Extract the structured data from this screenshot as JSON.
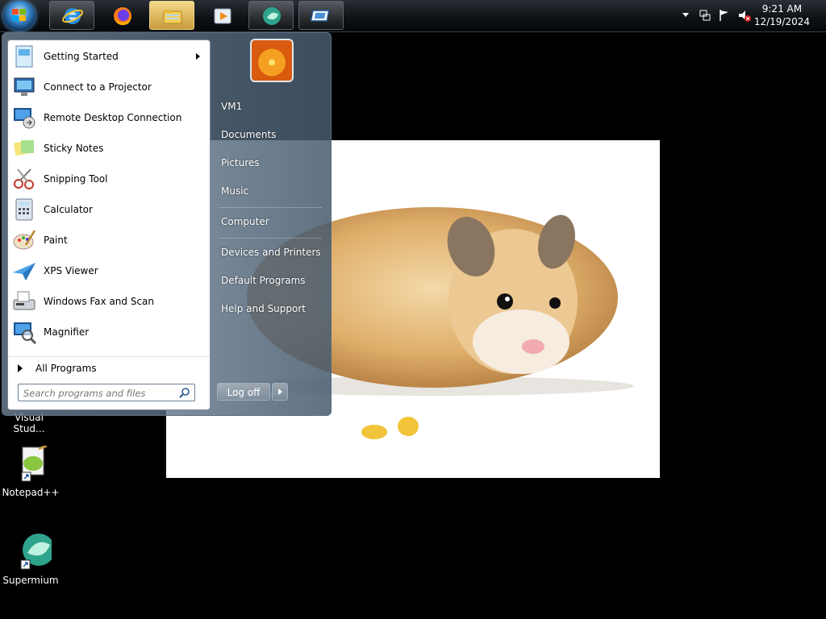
{
  "taskbar": {
    "pinned": [
      {
        "name": "internet-explorer",
        "active": false
      },
      {
        "name": "firefox",
        "active": false
      },
      {
        "name": "file-explorer",
        "active": true
      },
      {
        "name": "media-player",
        "active": false
      },
      {
        "name": "supermium",
        "active": false
      },
      {
        "name": "remote-desktop",
        "active": false
      }
    ],
    "clock": {
      "time": "9:21 AM",
      "date": "12/19/2024"
    }
  },
  "start_menu": {
    "programs": [
      {
        "label": "Getting Started",
        "icon": "getting-started-icon",
        "submenu": true
      },
      {
        "label": "Connect to a Projector",
        "icon": "projector-icon"
      },
      {
        "label": "Remote Desktop Connection",
        "icon": "remote-desktop-icon"
      },
      {
        "label": "Sticky Notes",
        "icon": "sticky-notes-icon"
      },
      {
        "label": "Snipping Tool",
        "icon": "scissors-icon"
      },
      {
        "label": "Calculator",
        "icon": "calculator-icon"
      },
      {
        "label": "Paint",
        "icon": "paint-palette-icon"
      },
      {
        "label": "XPS Viewer",
        "icon": "paper-plane-icon"
      },
      {
        "label": "Windows Fax and Scan",
        "icon": "fax-icon"
      },
      {
        "label": "Magnifier",
        "icon": "magnifier-icon"
      }
    ],
    "all_programs_label": "All Programs",
    "search_placeholder": "Search programs and files",
    "places": [
      {
        "label": "VM1"
      },
      {
        "label": "Documents"
      },
      {
        "label": "Pictures"
      },
      {
        "label": "Music"
      },
      {
        "label": "Computer"
      },
      {
        "label": "Devices and Printers"
      },
      {
        "label": "Default Programs"
      },
      {
        "label": "Help and Support"
      }
    ],
    "logoff_label": "Log off"
  },
  "desktop": {
    "icons": [
      {
        "label": "Visual Stud..."
      },
      {
        "label": "Notepad++"
      },
      {
        "label": "Supermium"
      }
    ]
  }
}
